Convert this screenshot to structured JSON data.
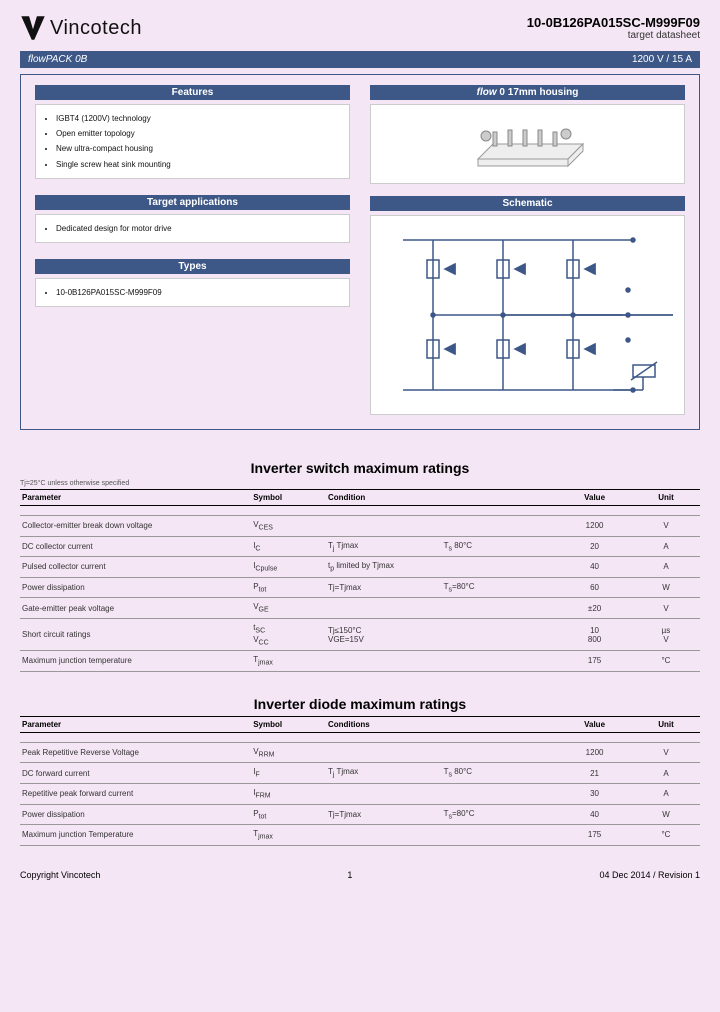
{
  "header": {
    "brand": "Vincotech",
    "part_number": "10-0B126PA015SC-M999F09",
    "subtitle": "target datasheet"
  },
  "infobar": {
    "left_italic": "flow",
    "left_rest": "PACK 0B",
    "right": "1200 V / 15 A"
  },
  "sections": {
    "features_title": "Features",
    "features": [
      "IGBT4 (1200V) technology",
      "Open emitter topology",
      "New ultra-compact housing",
      "Single screw heat sink mounting"
    ],
    "target_title": "Target applications",
    "target": [
      "Dedicated design for motor drive"
    ],
    "types_title": "Types",
    "types": [
      "10-0B126PA015SC-M999F09"
    ],
    "housing_title": "flow 0 17mm housing",
    "schematic_title": "Schematic"
  },
  "tables": {
    "switch_title": "Inverter switch maximum ratings",
    "switch_note": "Tj=25°C unless otherwise specified",
    "headers": [
      "Parameter",
      "Symbol",
      "Condition",
      "",
      "Value",
      "Unit"
    ],
    "headers2": [
      "Parameter",
      "Symbol",
      "Conditions",
      "",
      "Value",
      "Unit"
    ],
    "switch_rows": [
      {
        "param": "Collector-emitter break down voltage",
        "sym": "V<sub>CES</sub>",
        "c1": "",
        "c2": "",
        "val": "1200",
        "unit": "V"
      },
      {
        "param": "DC collector current",
        "sym": "I<sub>C</sub>",
        "c1": "T<sub>j</sub> Tjmax",
        "c2": "T<sub>s</sub> 80°C",
        "val": "20",
        "unit": "A"
      },
      {
        "param": "Pulsed collector current",
        "sym": "I<sub>Cpulse</sub>",
        "c1": "t<sub>p</sub> limited by Tjmax",
        "c2": "",
        "val": "40",
        "unit": "A"
      },
      {
        "param": "Power dissipation",
        "sym": "P<sub>tot</sub>",
        "c1": "Tj=Tjmax",
        "c2": "T<sub>s</sub>=80°C",
        "val": "60",
        "unit": "W"
      },
      {
        "param": "Gate-emitter peak voltage",
        "sym": "V<sub>GE</sub>",
        "c1": "",
        "c2": "",
        "val": "±20",
        "unit": "V"
      },
      {
        "param": "Short circuit ratings",
        "sym": "t<sub>SC</sub><br>V<sub>CC</sub>",
        "c1": "Tj≤150°C<br>VGE=15V",
        "c2": "",
        "val": "10<br>800",
        "unit": "µs<br>V"
      },
      {
        "param": "Maximum junction temperature",
        "sym": "T<sub>jmax</sub>",
        "c1": "",
        "c2": "",
        "val": "175",
        "unit": "°C"
      }
    ],
    "diode_title": "Inverter diode maximum ratings",
    "diode_rows": [
      {
        "param": "Peak Repetitive Reverse Voltage",
        "sym": "V<sub>RRM</sub>",
        "c1": "",
        "c2": "",
        "val": "1200",
        "unit": "V"
      },
      {
        "param": "DC forward current",
        "sym": "I<sub>F</sub>",
        "c1": "T<sub>j</sub> Tjmax",
        "c2": "T<sub>s</sub> 80°C",
        "val": "21",
        "unit": "A"
      },
      {
        "param": "Repetitive peak forward current",
        "sym": "I<sub>FRM</sub>",
        "c1": "",
        "c2": "",
        "val": "30",
        "unit": "A"
      },
      {
        "param": "Power dissipation",
        "sym": "P<sub>tot</sub>",
        "c1": "Tj=Tjmax",
        "c2": "T<sub>s</sub>=80°C",
        "val": "40",
        "unit": "W"
      },
      {
        "param": "Maximum junction Temperature",
        "sym": "T<sub>jmax</sub>",
        "c1": "",
        "c2": "",
        "val": "175",
        "unit": "°C"
      }
    ]
  },
  "footer": {
    "left": "Copyright Vincotech",
    "center": "1",
    "right": "04 Dec 2014 / Revision 1"
  }
}
